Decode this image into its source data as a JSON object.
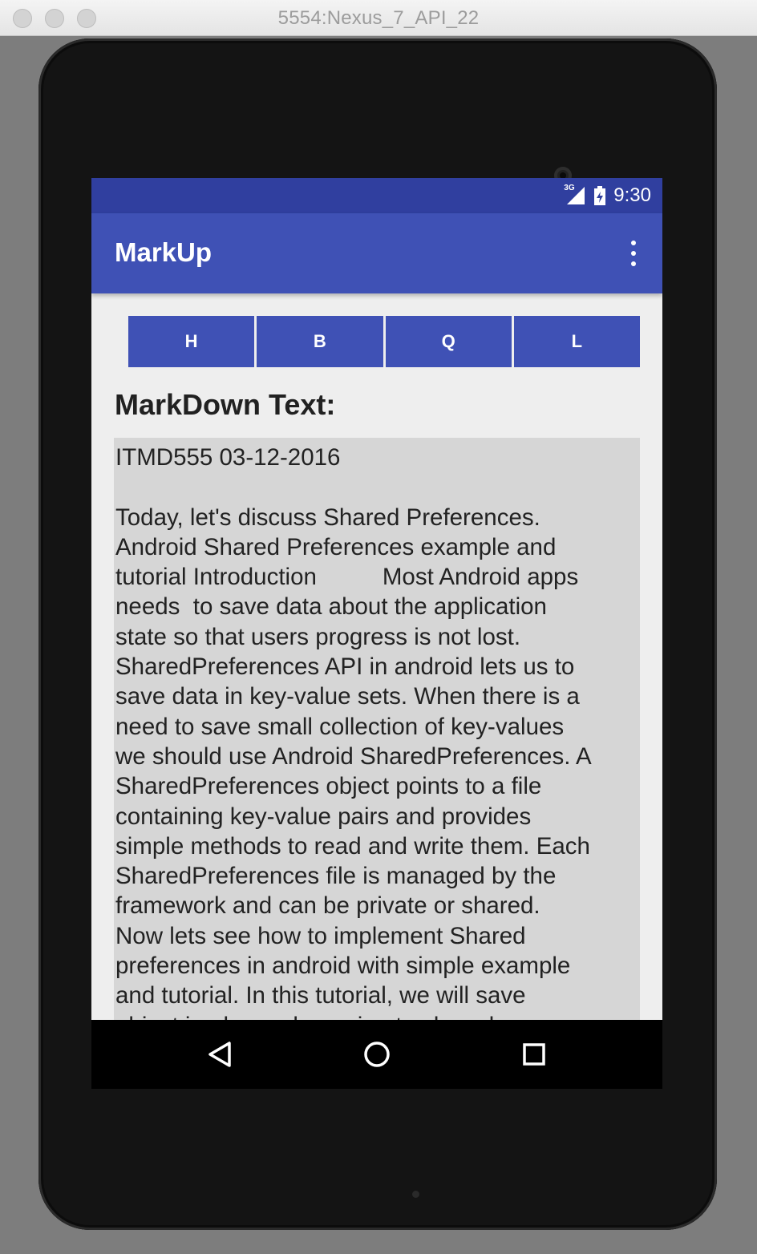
{
  "window": {
    "title": "5554:Nexus_7_API_22"
  },
  "status_bar": {
    "network_label": "3G",
    "time": "9:30"
  },
  "app_bar": {
    "title": "MarkUp",
    "menu_icon": "more-vert-icon"
  },
  "format_toolbar": {
    "buttons": [
      {
        "label": "H"
      },
      {
        "label": "B"
      },
      {
        "label": "Q"
      },
      {
        "label": "L"
      }
    ]
  },
  "content": {
    "section_label": "MarkDown Text:",
    "markdown_text": "ITMD555 03-12-2016\n\nToday, let's discuss Shared Preferences.\nAndroid Shared Preferences example and\ntutorial Introduction          Most Android apps\nneeds  to save data about the application\nstate so that users progress is not lost.\nSharedPreferences API in android lets us to\nsave data in key-value sets. When there is a\nneed to save small collection of key-values\nwe should use Android SharedPreferences. A\nSharedPreferences object points to a file\ncontaining key-value pairs and provides\nsimple methods to read and write them. Each\nSharedPreferences file is managed by the\nframework and can be private or shared.\nNow lets see how to implement Shared\npreferences in android with simple example\nand tutorial. In this tutorial, we will save\nobject i.e. key-value pairs, to shared"
  },
  "nav_bar": {
    "icons": [
      "back-icon",
      "home-icon",
      "recents-icon"
    ]
  },
  "colors": {
    "primary": "#3f51b5",
    "primary_dark": "#303f9f",
    "editor_background": "#d6d6d6"
  }
}
